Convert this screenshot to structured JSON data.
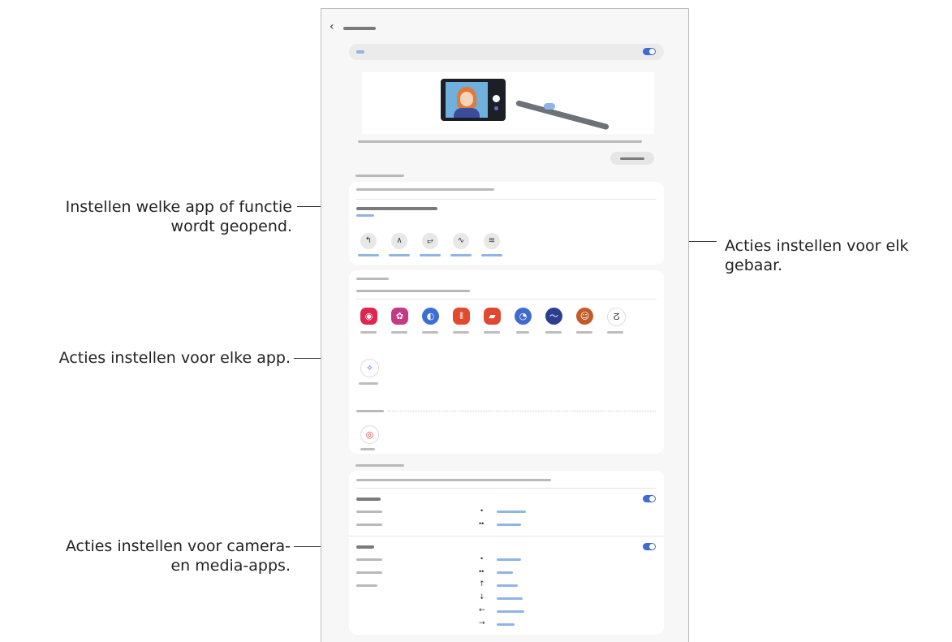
{
  "callouts": {
    "app_function": [
      "Instellen welke app of functie",
      "wordt geopend."
    ],
    "gestures": [
      "Acties instellen voor elk",
      "gebaar."
    ],
    "per_app": [
      "Acties instellen voor elke app."
    ],
    "camera_media": [
      "Acties instellen voor camera-",
      "en media-apps."
    ]
  },
  "icons": {
    "back": "‹",
    "gesture_glyphs": [
      "↰",
      "∧",
      "⥂",
      "∿",
      "≋"
    ],
    "arrows": [
      "↑",
      "↓",
      "←",
      "→"
    ],
    "single": "•",
    "double": "••"
  },
  "colors": {
    "frame": "#2c8ec8",
    "toggle": "#3e6ad1",
    "app_icons": [
      "#e0254f",
      "#c43a85",
      "#3b6fd6",
      "#e24a2c",
      "#e2482f",
      "#3e6ad1",
      "#2c3e8f",
      "#c35a2a",
      "#444444",
      "#ffffff",
      "#ffffff"
    ]
  }
}
